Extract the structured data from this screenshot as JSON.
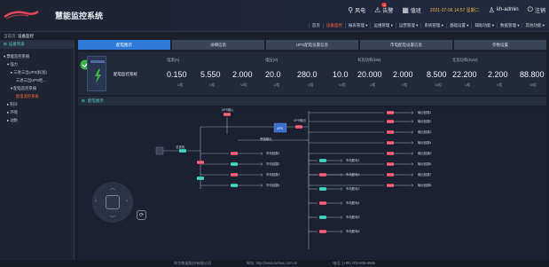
{
  "header": {
    "title": "慧能监控系统",
    "actions": [
      {
        "icon": "hierarchy-icon",
        "label": "风电"
      },
      {
        "icon": "alarm-icon",
        "label": "告警",
        "badge": "1"
      },
      {
        "icon": "calendar-icon",
        "label": "值班"
      }
    ],
    "datetime": "2021-07-06 14:57 星期二",
    "user": "kh-admin",
    "logout": "注销",
    "nav": [
      "首页",
      "设备监控",
      "报表管理 ▾",
      "运维管理 ▾",
      "运营管理 ▾",
      "系统管理 ▾",
      "基础设置 ▾",
      "辅助功能 ▾",
      "数据管理 ▾",
      "其他功能 ▾"
    ]
  },
  "breadcrumb": {
    "prefix": "当前页:",
    "current": "设备监控"
  },
  "sidebar": {
    "title": "设备列表",
    "tree": [
      {
        "label": "▾ 慧能监控系统",
        "indent": 0
      },
      {
        "label": "▾ 强力",
        "indent": 1
      },
      {
        "label": "▸ 三进三出UPS(标准)",
        "indent": 2
      },
      {
        "label": "三进三出UPS柜...",
        "indent": 3
      },
      {
        "label": "▾ 配电监控系统",
        "indent": 2
      },
      {
        "label": "配电监控系统",
        "indent": 3,
        "selected": true
      },
      {
        "label": "▸ 制冷",
        "indent": 1
      },
      {
        "label": "▸ 环境",
        "indent": 1
      },
      {
        "label": "▸ 动防",
        "indent": 1
      }
    ]
  },
  "tabs": [
    "配电图示",
    "详细信息",
    "UPS配电设置信息",
    "市电配电设置信息",
    "参数设置"
  ],
  "device": {
    "label": "配电监控系统"
  },
  "metrics": [
    {
      "title": "电流(A)",
      "values": [
        "0.150",
        "5.550",
        "2.000"
      ],
      "units": [
        "U相",
        "V相",
        "W相"
      ]
    },
    {
      "title": "电压(V)",
      "values": [
        "20.0",
        "280.0",
        "10.0"
      ],
      "units": [
        "U相",
        "V相",
        "W相"
      ]
    },
    {
      "title": "有功功率(kW)",
      "values": [
        "20.000",
        "2.000",
        "8.500"
      ],
      "units": [
        "U相",
        "V相",
        "W相"
      ]
    },
    {
      "title": "无功功率(kVar)",
      "values": [
        "22.200",
        "2.200",
        "88.800"
      ],
      "units": [
        "U相",
        "V相",
        "W相"
      ]
    }
  ],
  "diagram": {
    "title": "配电图示",
    "ups_label": "UPS",
    "ups_in": "UPS输入",
    "ups_out": "UPS输出",
    "main_in": "总进线",
    "bus_label": "旁路输出",
    "right_outputs": [
      "输出回路1",
      "输出回路2",
      "输出回路3",
      "输出回路4",
      "输出回路5",
      "输出回路6",
      "输出回路7",
      "输出回路8"
    ],
    "mid_outputs": [
      "市电回路1",
      "市电回路2",
      "市电回路3",
      "市电回路4"
    ],
    "low_outputs": [
      "市电配电1",
      "市电配电2",
      "市电配电3",
      "市电配电4",
      "市电配电5",
      "市电配电6"
    ],
    "colors": {
      "breaker_on": "#e0455a",
      "breaker_off": "#27c4b0",
      "line": "#9aa3b2",
      "ups": "#3a6fd0"
    }
  },
  "footer": {
    "company": "科华数据股份有限公司",
    "site": "网址: http://www.kehua.com.cn",
    "phone": "电话: (+86) 400-808-9986"
  }
}
